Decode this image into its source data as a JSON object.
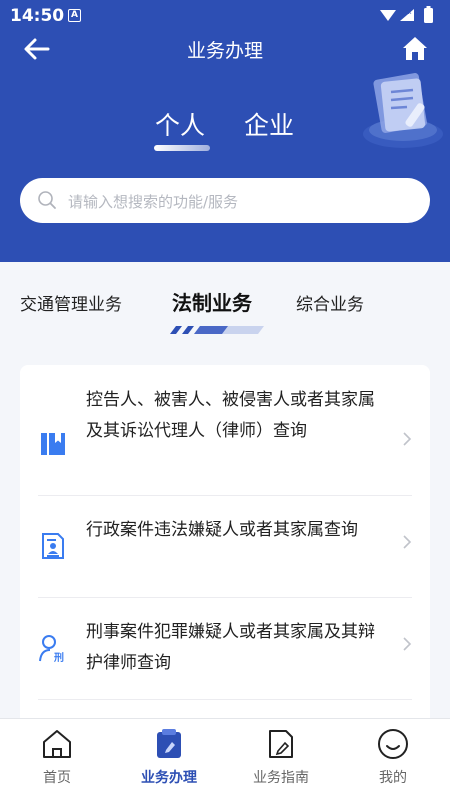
{
  "status_bar": {
    "time": "14:50",
    "notification_badge": "A"
  },
  "nav": {
    "title": "业务办理",
    "back_icon": "arrow-left-icon",
    "home_icon": "home-icon"
  },
  "segment": {
    "tabs": [
      "个人",
      "企业"
    ],
    "active": "个人"
  },
  "search": {
    "placeholder": "请输入想搜索的功能/服务"
  },
  "categories": {
    "tabs": [
      "交通管理业务",
      "法制业务",
      "综合业务"
    ],
    "active": "法制业务"
  },
  "services": [
    {
      "text": "控告人、被害人、被侵害人或者其家属及其诉讼代理人（律师）查询",
      "icon": "book-icon"
    },
    {
      "text": "行政案件违法嫌疑人或者其家属查询",
      "icon": "id-document-icon"
    },
    {
      "text": "刑事案件犯罪嫌疑人或者其家属及其辩护律师查询",
      "icon": "person-criminal-icon",
      "icon_label": "刑"
    }
  ],
  "bottom_nav": [
    {
      "label": "首页",
      "icon": "home-icon"
    },
    {
      "label": "业务办理",
      "icon": "clipboard-icon",
      "active": true
    },
    {
      "label": "业务指南",
      "icon": "guide-icon"
    },
    {
      "label": "我的",
      "icon": "smile-icon"
    }
  ],
  "colors": {
    "primary": "#2d4fb4",
    "accent_blue": "#3a7cf0",
    "background": "#f4f6fa"
  }
}
